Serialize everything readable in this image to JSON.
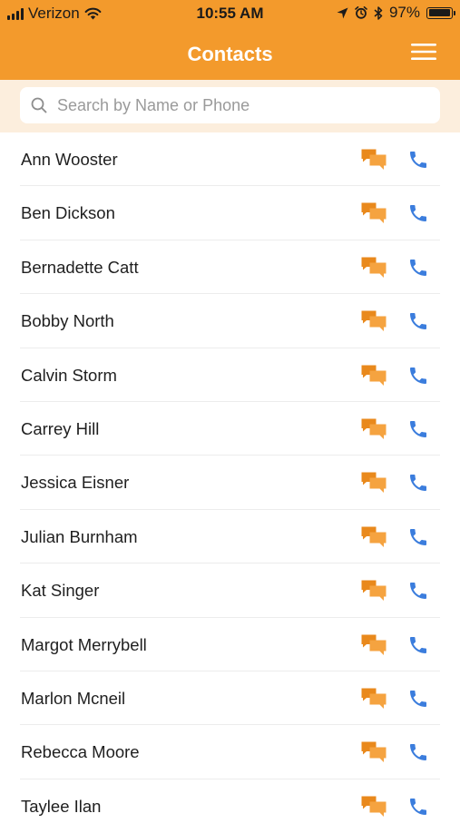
{
  "status_bar": {
    "carrier": "Verizon",
    "time": "10:55 AM",
    "battery_text": "97%",
    "battery_level": 0.97,
    "signal_bars": 4,
    "icons": [
      "signal-icon",
      "wifi-icon",
      "location-arrow-icon",
      "alarm-icon",
      "bluetooth-icon",
      "battery-icon"
    ]
  },
  "header": {
    "title": "Contacts",
    "menu_icon": "hamburger-menu-icon"
  },
  "search": {
    "placeholder": "Search by Name or Phone",
    "value": "",
    "icon": "search-icon"
  },
  "contacts": [
    {
      "name": "Ann Wooster"
    },
    {
      "name": "Ben Dickson"
    },
    {
      "name": "Bernadette Catt"
    },
    {
      "name": "Bobby North"
    },
    {
      "name": "Calvin Storm"
    },
    {
      "name": "Carrey Hill"
    },
    {
      "name": "Jessica Eisner"
    },
    {
      "name": "Julian Burnham"
    },
    {
      "name": "Kat Singer"
    },
    {
      "name": "Margot Merrybell"
    },
    {
      "name": "Marlon Mcneil"
    },
    {
      "name": "Rebecca Moore"
    },
    {
      "name": "Taylee Ilan"
    }
  ],
  "row_actions": {
    "message_icon": "chat-bubbles-icon",
    "call_icon": "phone-icon"
  },
  "colors": {
    "brand": "#F39A2C",
    "search_band": "#FCEEDD",
    "call_blue": "#3B7DDD",
    "message_orange": "#F39A2C"
  }
}
